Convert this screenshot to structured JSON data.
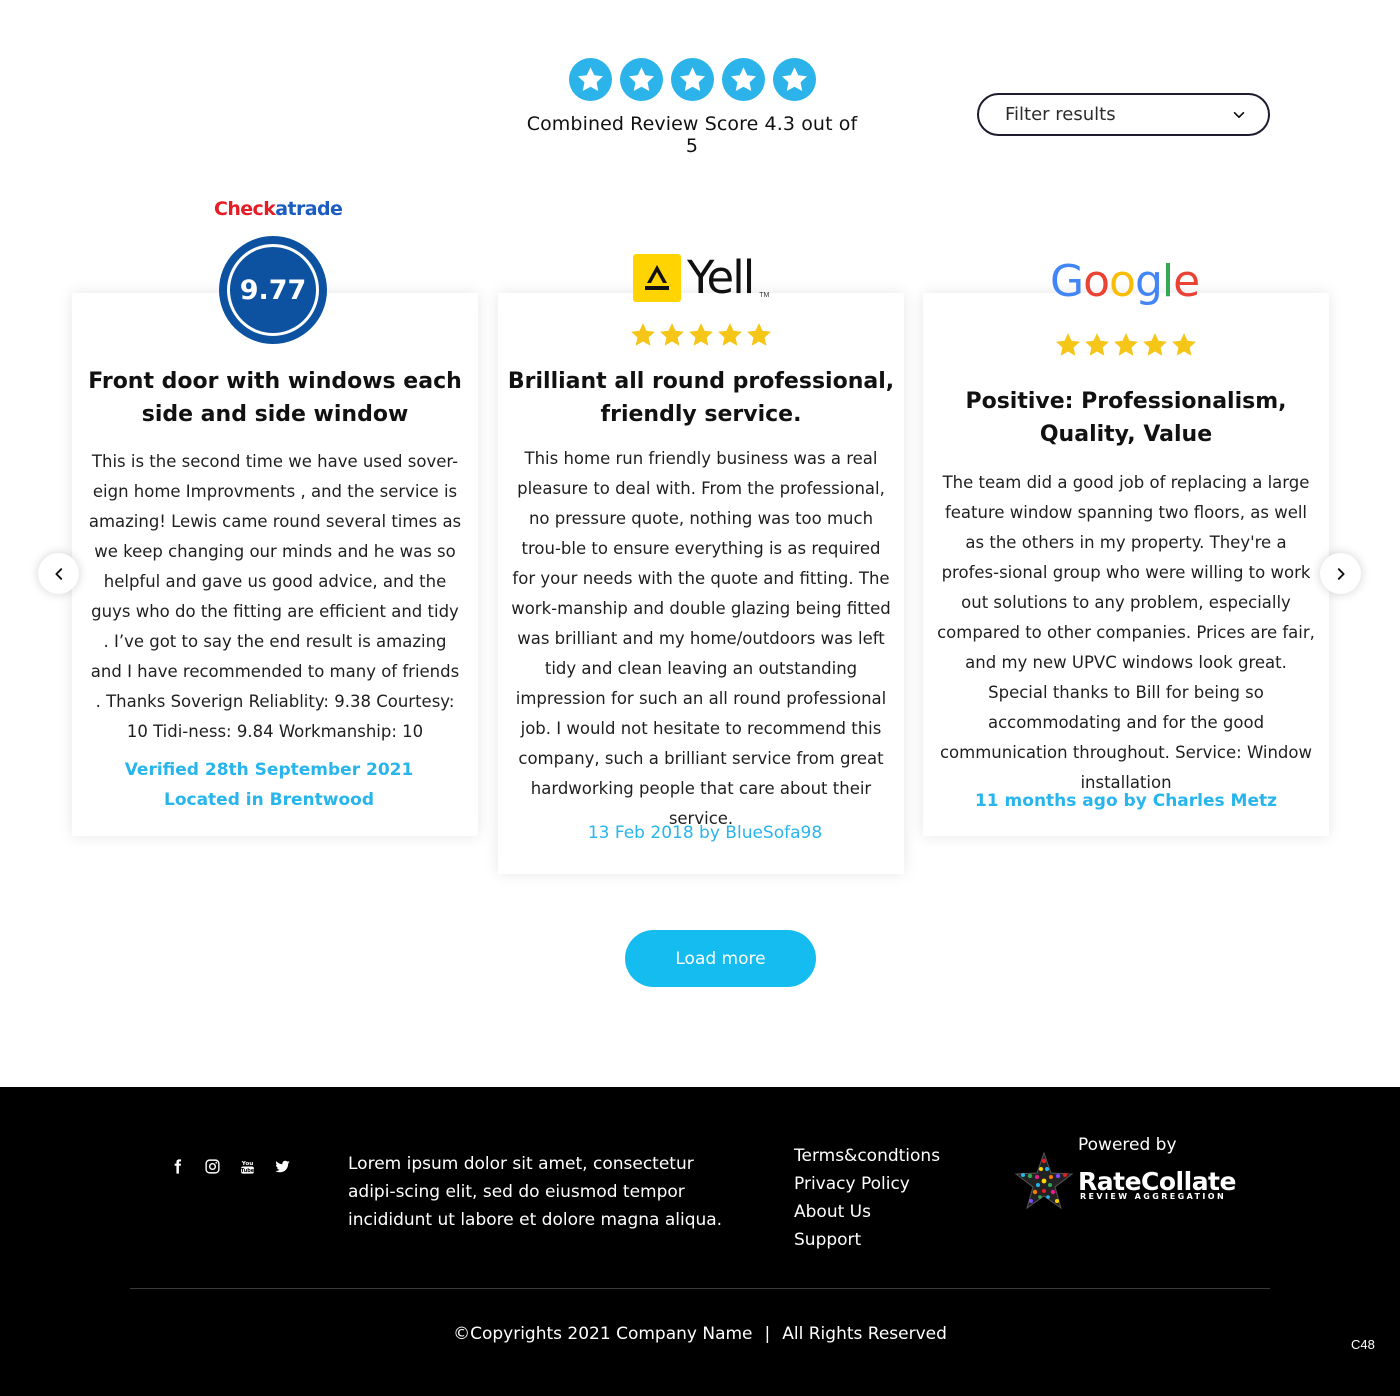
{
  "header": {
    "score_text": "Combined Review Score 4.3 out of 5",
    "score_stars": 5,
    "accent": "#2bb3ea",
    "filter": {
      "label": "Filter results",
      "icon": "chevron-down-icon"
    }
  },
  "reviews": [
    {
      "source": "Checkatrade",
      "logo_parts": [
        "Chec",
        "k",
        "a",
        "trade"
      ],
      "rating": "9.77",
      "title": "Front door with windows each side and side window",
      "body": "This is the second time we have used sover-eign home Improvments , and the service is amazing! Lewis came round several times as we keep changing our minds and he was so helpful and gave us good advice, and the guys who do the fitting are efficient and tidy . I’ve got to say the end result is amazing and I have recommended to many of friends . Thanks Soverign Reliablity: 9.38 Courtesy: 10 Tidi-ness: 9.84 Workmanship: 10",
      "meta_line1": "Verified 28th September 2021",
      "meta_line2": "Located in Brentwood"
    },
    {
      "source": "Yell",
      "logo_word": "Yell",
      "logo_tm": "TM",
      "stars": 5,
      "title": "Brilliant all round professional, friendly service.",
      "body": "This home run friendly business was a real pleasure to deal with. From the professional, no pressure quote, nothing was too much trou-ble to ensure everything is as required for your needs with the quote and fitting. The work-manship and double glazing being fitted was brilliant and my home/outdoors was left tidy and clean leaving an outstanding impression for such an all round professional job. I would not hesitate to recommend this company, such a brilliant service from great hardworking people that care about their service.",
      "meta": "13 Feb 2018 by BlueSofa98"
    },
    {
      "source": "Google",
      "logo_letters": [
        "G",
        "o",
        "o",
        "g",
        "l",
        "e"
      ],
      "stars": 5,
      "title": "Positive: Professionalism, Quality, Value",
      "body": "The team did a good job of replacing a large feature window spanning two floors, as well as the others in my property. They're a profes-sional group who were willing to work out solutions to any problem, especially compared to other companies. Prices are fair, and my new UPVC windows look great. Special thanks to Bill for being so accommodating and for the good communication throughout. Service: Window installation",
      "meta": "11 months ago by Charles Metz"
    }
  ],
  "carousel": {
    "prev_icon": "chevron-left-icon",
    "next_icon": "chevron-right-icon"
  },
  "load_more": "Load more",
  "footer": {
    "social_icons": [
      "facebook-icon",
      "instagram-icon",
      "youtube-icon",
      "twitter-icon"
    ],
    "text": "Lorem ipsum dolor sit amet, consectetur adipi-scing elit, sed do eiusmod tempor incididunt ut labore et dolore magna aliqua.",
    "links": [
      "Terms&condtions",
      "Privacy Policy",
      "About Us",
      "Support"
    ],
    "powered_by": "Powered by",
    "brand_name": "RateCollate",
    "brand_tagline": "REVIEW AGGREGATION",
    "copyright": "©Copyrights 2021 Company Name",
    "separator": "|",
    "rights": "All Rights Reserved",
    "corner_code": "C48"
  },
  "colors": {
    "accent_blue": "#27b5ec",
    "button": "#14bcef",
    "star_gold": "#f5c518",
    "checkatrade_blue": "#0c52a0",
    "checkatrade_red": "#e41e26",
    "yell_yellow": "#ffd400",
    "footer_bg": "#000000"
  }
}
